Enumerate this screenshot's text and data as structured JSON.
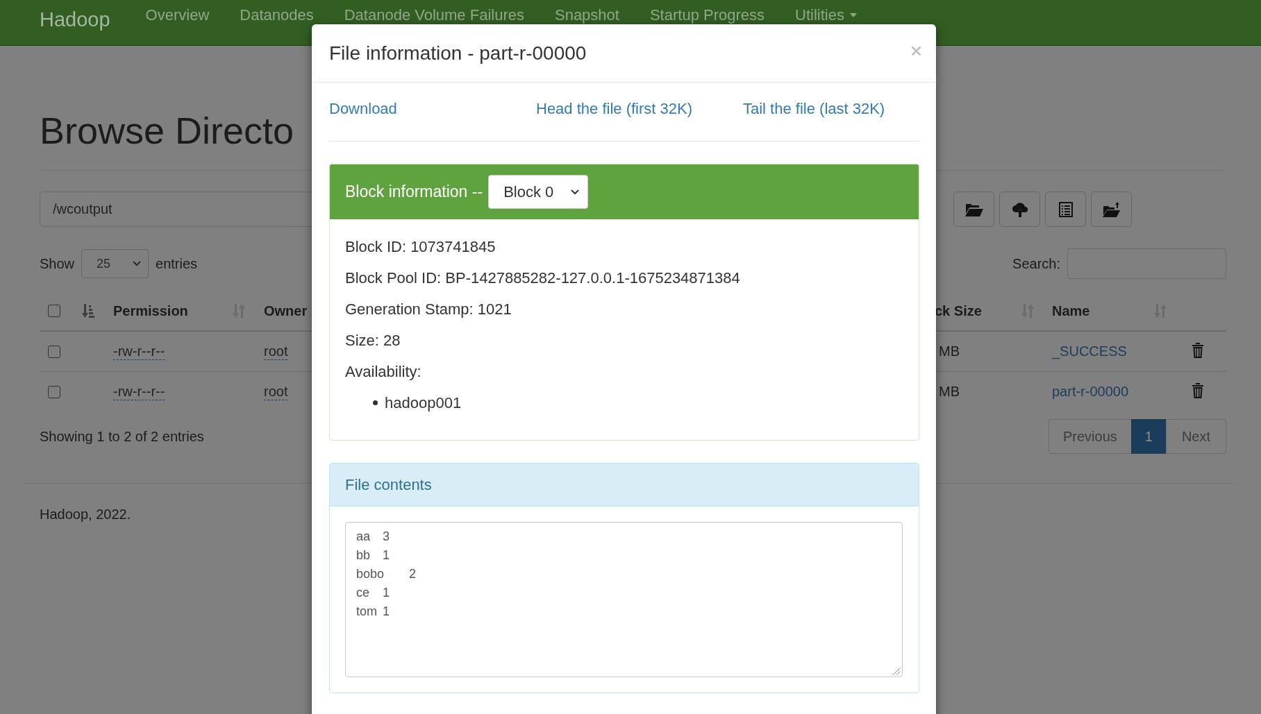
{
  "navbar": {
    "brand": "Hadoop",
    "items": [
      {
        "label": "Overview",
        "dropdown": false
      },
      {
        "label": "Datanodes",
        "dropdown": false
      },
      {
        "label": "Datanode Volume Failures",
        "dropdown": false
      },
      {
        "label": "Snapshot",
        "dropdown": false
      },
      {
        "label": "Startup Progress",
        "dropdown": false
      },
      {
        "label": "Utilities",
        "dropdown": true
      }
    ]
  },
  "page": {
    "title": "Browse Directo",
    "path": "/wcoutput",
    "length_menu": {
      "label_before": "Show",
      "value": "25",
      "label_after": "entries"
    },
    "search": {
      "label": "Search:"
    },
    "table": {
      "header_left": [
        {
          "kind": "checkbox",
          "checked": false
        },
        {
          "kind": "sort",
          "sorted": true
        },
        {
          "kind": "label",
          "label": "Permission",
          "sort_icon": true
        },
        {
          "kind": "label",
          "label": "Owner",
          "sort_icon": false
        }
      ],
      "header_right": [
        {
          "kind": "label",
          "label": "ck Size",
          "sort_icon": true
        },
        {
          "kind": "label",
          "label": "Name",
          "sort_icon": true
        }
      ],
      "rows": [
        {
          "checked": false,
          "permission": "-rw-r--r--",
          "owner": "root",
          "size": "MB",
          "name": "_SUCCESS"
        },
        {
          "checked": false,
          "permission": "-rw-r--r--",
          "owner": "root",
          "size": "MB",
          "name": "part-r-00000"
        }
      ]
    },
    "info": "Showing 1 to 2 of 2 entries",
    "pagination": [
      {
        "label": "Previous",
        "selected": false,
        "disabled": true
      },
      {
        "label": "1",
        "selected": true,
        "disabled": false
      },
      {
        "label": "Next",
        "selected": false,
        "disabled": true
      }
    ],
    "footer": "Hadoop, 2022."
  },
  "dialog": {
    "title": "File information - part-r-00000",
    "links": [
      "Download",
      "Head the file (first 32K)",
      "Tail the file (last 32K)"
    ],
    "block_panel": {
      "title": "Block information --",
      "block_select": "Block 0",
      "lines": [
        "Block ID: 1073741845",
        "Block Pool ID: BP-1427885282-127.0.0.1-1675234871384",
        "Generation Stamp: 1021",
        "Size: 28",
        "Availability:"
      ],
      "availability": [
        "hadoop001"
      ]
    },
    "contents_panel": {
      "title": "File contents",
      "text": "aa\t3\nbb\t1\nbobo\t2\nce\t1\ntom\t1"
    }
  }
}
